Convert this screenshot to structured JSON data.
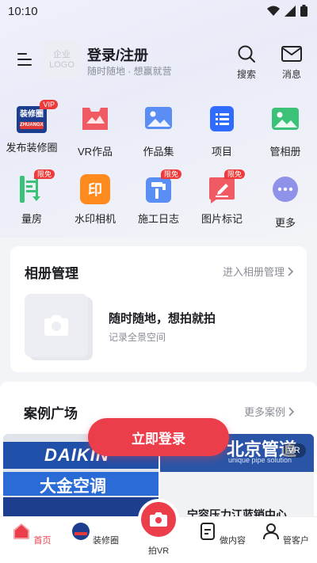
{
  "status_bar": {
    "time": "10:10"
  },
  "header": {
    "logo_line1": "企业",
    "logo_line2": "LOGO",
    "login_title": "登录/注册",
    "login_subtitle": "随时随地 · 想赢就营",
    "search_label": "搜索",
    "message_label": "消息"
  },
  "grid": [
    {
      "label": "发布装修圈",
      "icon": "decor-circle-icon",
      "tag": "VIP",
      "icon_text": "装修圈",
      "icon_sub": "ZHUANGXIUQUAN"
    },
    {
      "label": "VR作品",
      "icon": "vr-icon"
    },
    {
      "label": "作品集",
      "icon": "image-gallery-icon"
    },
    {
      "label": "项目",
      "icon": "project-list-icon"
    },
    {
      "label": "管相册",
      "icon": "album-icon"
    },
    {
      "label": "量房",
      "icon": "measure-room-icon",
      "tag": "限免"
    },
    {
      "label": "水印相机",
      "icon": "watermark-camera-icon",
      "icon_text": "印"
    },
    {
      "label": "施工日志",
      "icon": "construction-log-icon",
      "tag": "限免"
    },
    {
      "label": "图片标记",
      "icon": "image-mark-icon",
      "tag": "限免"
    },
    {
      "label": "更多",
      "icon": "more-icon"
    }
  ],
  "album_card": {
    "title": "相册管理",
    "link": "进入相册管理",
    "headline": "随时随地，想拍就拍",
    "subline": "记录全景空间"
  },
  "case_section": {
    "title": "案例广场",
    "link": "更多案例",
    "case1_brand": "DAIKIN",
    "case1_text": "大金空调",
    "case2_brand": "北京管道",
    "case2_sub": "unique pipe solution",
    "case2_badge": "VR",
    "case2_bottom": "宁容压力江蓝销中心"
  },
  "login_button": "立即登录",
  "tabbar": [
    {
      "label": "首页",
      "icon": "home-icon",
      "active": true
    },
    {
      "label": "装修圈",
      "icon": "decor-circle-tab-icon",
      "active": false
    },
    {
      "label": "拍VR",
      "icon": "camera-icon",
      "active": false
    },
    {
      "label": "做内容",
      "icon": "content-icon",
      "active": false
    },
    {
      "label": "管客户",
      "icon": "customer-icon",
      "active": false
    }
  ],
  "colors": {
    "accent": "#ec3d4a",
    "blue": "#2f6bff",
    "green": "#3cc178",
    "orange": "#ff8a1e"
  }
}
